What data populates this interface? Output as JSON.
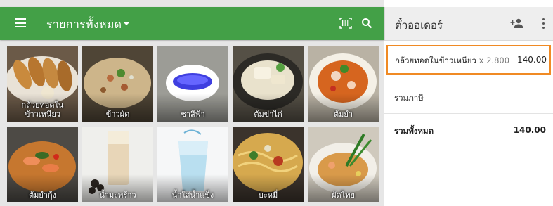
{
  "header": {
    "category_title": "รายการทั้งหมด"
  },
  "items": [
    {
      "name": "กล้วยทอดใน\nข้าวเหนียว",
      "label_line1": "กล้วยทอดใน",
      "label_line2": "ข้าวเหนียว",
      "theme": "banana"
    },
    {
      "name": "ข้าวผัด",
      "label_line1": "",
      "label_line2": "ข้าวผัด",
      "theme": "friedrice"
    },
    {
      "name": "ชาสีฟ้า",
      "label_line1": "",
      "label_line2": "ชาสีฟ้า",
      "theme": "bluetea"
    },
    {
      "name": "ต้มข่าไก่",
      "label_line1": "",
      "label_line2": "ต้มข่าไก่",
      "theme": "tomkha"
    },
    {
      "name": "ต้มยำ",
      "label_line1": "",
      "label_line2": "ต้มยำ",
      "theme": "tomyum"
    },
    {
      "name": "ต้มยำกุ้ง",
      "label_line1": "",
      "label_line2": "ต้มยำกุ้ง",
      "theme": "tomyumkung"
    },
    {
      "name": "น้ำมะพร้าว",
      "label_line1": "",
      "label_line2": "น้ำมะพร้าว",
      "theme": "coconut"
    },
    {
      "name": "น้ำใส่น้ำแข็ง",
      "label_line1": "",
      "label_line2": "น้ำใส่น้ำแข็ง",
      "theme": "water"
    },
    {
      "name": "บะหมี่",
      "label_line1": "",
      "label_line2": "บะหมี่",
      "theme": "noodle"
    },
    {
      "name": "ผัดไทย",
      "label_line1": "",
      "label_line2": "ผัดไทย",
      "theme": "padthai"
    }
  ],
  "ticket": {
    "title": "ตั๋วออเดอร์",
    "line_items": [
      {
        "name": "กล้วยทอดในข้าวเหนียว",
        "qty": "x 2.800",
        "price": "140.00"
      }
    ],
    "tax_label": "รวมภาษี",
    "tax_value": "",
    "total_label": "รวมทั้งหมด",
    "total_value": "140.00"
  },
  "icons": {
    "menu": "hamburger-menu-icon",
    "barcode": "barcode-scan-icon",
    "search": "search-icon",
    "add_customer": "add-customer-icon",
    "more": "more-vert-icon"
  },
  "colors": {
    "toolbar": "#43a047",
    "selected_outline": "#f08a24",
    "ticket_bar": "#eeeeee"
  }
}
